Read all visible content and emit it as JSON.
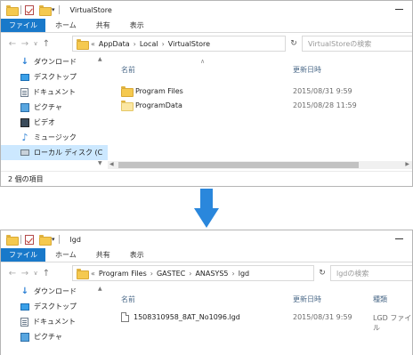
{
  "window1": {
    "title": "VirtualStore",
    "ribbon_tabs": [
      "ファイル",
      "ホーム",
      "共有",
      "表示"
    ],
    "address": {
      "chevron": "«",
      "segments": [
        "AppData",
        "Local",
        "VirtualStore"
      ]
    },
    "search_placeholder": "VirtualStoreの検索",
    "nav_items": [
      "ダウンロード",
      "デスクトップ",
      "ドキュメント",
      "ピクチャ",
      "ビデオ",
      "ミュージック",
      "ローカル ディスク (C"
    ],
    "columns": {
      "name": "名前",
      "date": "更新日時"
    },
    "files": [
      {
        "name": "Program Files",
        "date": "2015/08/31 9:59"
      },
      {
        "name": "ProgramData",
        "date": "2015/08/28 11:59"
      }
    ],
    "status": "2 個の項目"
  },
  "window2": {
    "title": "lgd",
    "ribbon_tabs": [
      "ファイル",
      "ホーム",
      "共有",
      "表示"
    ],
    "address": {
      "chevron": "«",
      "segments": [
        "Program Files",
        "GASTEC",
        "ANASYS5",
        "lgd"
      ]
    },
    "search_placeholder": "lgdの検索",
    "nav_items": [
      "ダウンロード",
      "デスクトップ",
      "ドキュメント",
      "ピクチャ"
    ],
    "columns": {
      "name": "名前",
      "date": "更新日時",
      "type": "種類"
    },
    "files": [
      {
        "name": "1508310958_8AT_No1096.lgd",
        "date": "2015/08/31 9:59",
        "type": "LGD ファイル"
      }
    ]
  },
  "colors": {
    "file_tab": "#1979ca",
    "arrow": "#2a87dc",
    "selected": "#cce8ff"
  }
}
